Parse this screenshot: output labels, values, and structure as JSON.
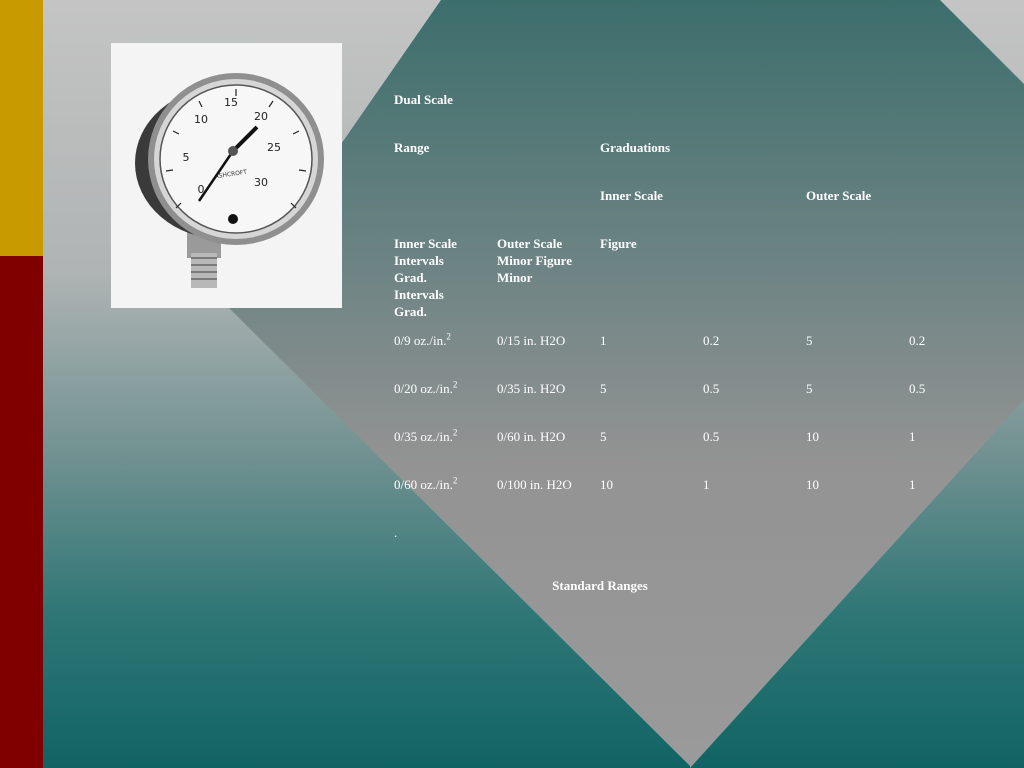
{
  "colors": {
    "gold_bar": "#c99a00",
    "red_bar": "#800000",
    "diamond": "#999999",
    "text": "#ffffff"
  },
  "image": {
    "gauge_numbers": [
      "0",
      "5",
      "10",
      "15",
      "20",
      "25",
      "30"
    ],
    "brand": "ASHCROFT"
  },
  "table": {
    "title": "Dual Scale",
    "range_label": "Range",
    "graduations_label": "Graduations",
    "inner_scale_label": "Inner Scale",
    "outer_scale_label": "Outer Scale",
    "col_inner_scale": "Inner Scale Intervals Grad. Intervals Grad.",
    "col_outer_scale": "Outer Scale Minor Figure Minor",
    "col_figure": "Figure",
    "rows": [
      {
        "inner": "0/9 oz./in.",
        "outer": "0/15 in. H2O",
        "inner_fig": "1",
        "inner_minor": "0.2",
        "outer_fig": "5",
        "outer_minor": "0.2"
      },
      {
        "inner": "0/20 oz./in.",
        "outer": "0/35 in. H2O",
        "inner_fig": "5",
        "inner_minor": "0.5",
        "outer_fig": "5",
        "outer_minor": "0.5"
      },
      {
        "inner": "0/35 oz./in.",
        "outer": "0/60 in. H2O",
        "inner_fig": "5",
        "inner_minor": "0.5",
        "outer_fig": "10",
        "outer_minor": "1"
      },
      {
        "inner": "0/60 oz./in.",
        "outer": "0/100 in. H2O",
        "inner_fig": "10",
        "inner_minor": "1",
        "outer_fig": "10",
        "outer_minor": "1"
      }
    ],
    "superscript": "2",
    "dot": "."
  },
  "caption": "Standard Ranges"
}
